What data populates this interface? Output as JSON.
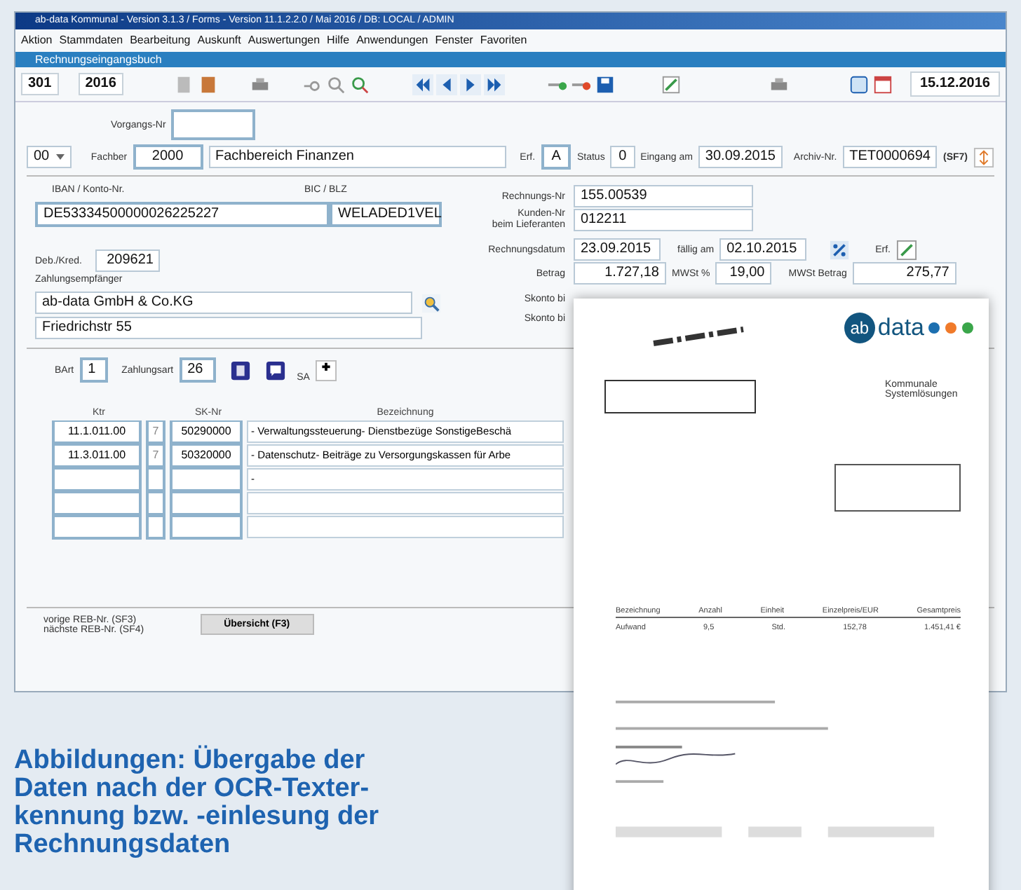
{
  "window": {
    "title": "ab-data Kommunal - Version 3.1.3 / Forms - Version 11.1.2.2.0 / Mai 2016 / DB: LOCAL / ADMIN"
  },
  "menu": [
    "Aktion",
    "Stammdaten",
    "Bearbeitung",
    "Auskunft",
    "Auswertungen",
    "Hilfe",
    "Anwendungen",
    "Fenster",
    "Favoriten"
  ],
  "form_title": "Rechnungseingangsbuch",
  "toolbar": {
    "number": "301",
    "year": "2016",
    "date": "15.12.2016"
  },
  "header": {
    "vorgang_label": "Vorgangs-Nr",
    "select": "00",
    "fachber_label": "Fachber",
    "fachber": "2000",
    "fachbereich": "Fachbereich Finanzen",
    "erf_label": "Erf.",
    "erf": "A",
    "status_label": "Status",
    "status": "0",
    "eingang_label": "Eingang am",
    "eingang": "30.09.2015",
    "archiv_label": "Archiv-Nr.",
    "archiv": "TET0000694",
    "archiv_key": "(SF7)"
  },
  "payee": {
    "iban_label": "IBAN / Konto-Nr.",
    "iban": "DE53334500000026225227",
    "bic_label": "BIC / BLZ",
    "bic": "WELADED1VEL",
    "deb_label": "Deb./Kred.",
    "deb": "209621",
    "name_label": "Zahlungsempfänger",
    "name": "ab-data GmbH & Co.KG",
    "street": "Friedrichstr 55"
  },
  "invoice": {
    "nr_label": "Rechnungs-Nr",
    "nr": "155.00539",
    "kunden_label": "Kunden-Nr",
    "kunden_label2": "beim Lieferanten",
    "kunden": "012211",
    "datum_label": "Rechnungsdatum",
    "datum": "23.09.2015",
    "faellig_label": "fällig am",
    "faellig": "02.10.2015",
    "erf_label": "Erf.",
    "betrag_label": "Betrag",
    "betrag": "1.727,18",
    "mwst_label": "MWSt %",
    "mwst": "19,00",
    "mwstb_label": "MWSt Betrag",
    "mwstb": "275,77",
    "skonto_labels": [
      "Skonto bi",
      "Skonto bi"
    ]
  },
  "payment": {
    "bart_label": "BArt",
    "bart": "1",
    "zahlungsart_label": "Zahlungsart",
    "zahlungsart": "26",
    "sa_label": "SA"
  },
  "table": {
    "columns": [
      "Ktr",
      "SK-Nr",
      "Bezeichnung"
    ],
    "rows": [
      {
        "ktr": "11.1.011.00",
        "idx": "7",
        "sk": "50290000",
        "text": "- Verwaltungssteuerung- Dienstbezüge SonstigeBeschä"
      },
      {
        "ktr": "11.3.011.00",
        "idx": "7",
        "sk": "50320000",
        "text": "- Datenschutz- Beiträge zu Versorgungskassen für Arbe"
      },
      {
        "text": "-"
      },
      {},
      {}
    ]
  },
  "footer": {
    "prev": "vorige REB-Nr. (SF3)",
    "next": "nächste REB-Nr. (SF4)",
    "button": "Übersicht (F3)"
  },
  "document": {
    "logo_a": "ab",
    "logo_b": "data",
    "company": "Kommunale Systemlösungen",
    "columns": [
      "Bezeichnung",
      "Anzahl",
      "Einheit",
      "Einzelpreis/EUR",
      "Gesamtpreis"
    ],
    "row": [
      "Aufwand",
      "9,5",
      "Std.",
      "152,78",
      "1.451,41 €"
    ]
  },
  "caption": {
    "lines": [
      "Abbildungen: Übergabe der",
      "Daten nach der OCR-Texter-",
      "kennung bzw. -einlesung der",
      "Rechnungsdaten"
    ]
  }
}
